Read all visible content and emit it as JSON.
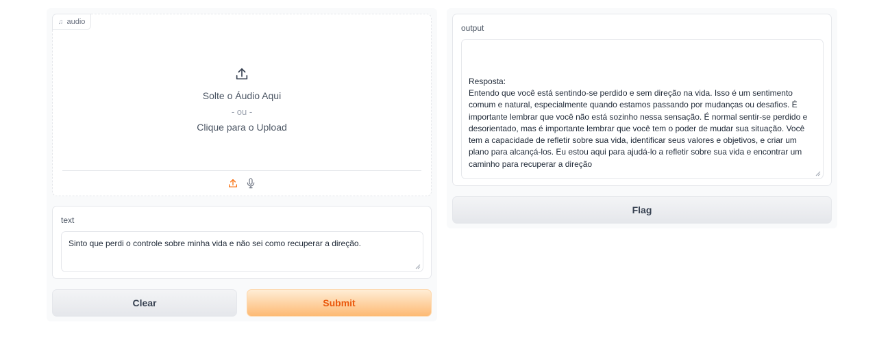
{
  "audio": {
    "label": "audio",
    "label_icon": "music-note-icon",
    "drop_text": "Solte o Áudio Aqui",
    "or_text": "- ou -",
    "click_text": "Clique para o Upload",
    "sources": [
      "upload-icon",
      "microphone-icon"
    ],
    "accent_color": "#f97316"
  },
  "text_input": {
    "label": "text",
    "value": "Sinto que perdi o controle sobre minha vida e não sei como recuperar a direção."
  },
  "buttons": {
    "clear": "Clear",
    "submit": "Submit",
    "flag": "Flag"
  },
  "output": {
    "label": "output",
    "value": "Resposta:\nEntendo que você está sentindo-se perdido e sem direção na vida. Isso é um sentimento comum e natural, especialmente quando estamos passando por mudanças ou desafios. É importante lembrar que você não está sozinho nessa sensação. É normal sentir-se perdido e desorientado, mas é importante lembrar que você tem o poder de mudar sua situação. Você tem a capacidade de refletir sobre sua vida, identificar seus valores e objetivos, e criar um plano para alcançá-los. Eu estou aqui para ajudá-lo a refletir sobre sua vida e encontrar um caminho para recuperar a direção"
  }
}
